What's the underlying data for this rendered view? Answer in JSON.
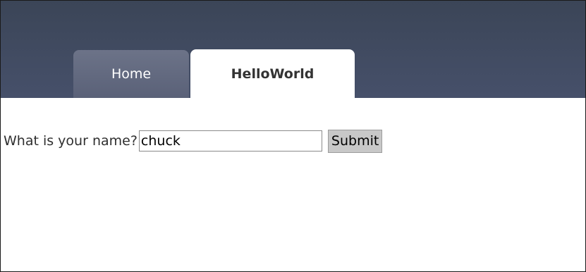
{
  "nav": {
    "tabs": [
      {
        "label": "Home",
        "active": false
      },
      {
        "label": "HelloWorld",
        "active": true
      }
    ]
  },
  "form": {
    "question": "What is your name?",
    "name_value": "chuck",
    "submit_label": "Submit"
  }
}
